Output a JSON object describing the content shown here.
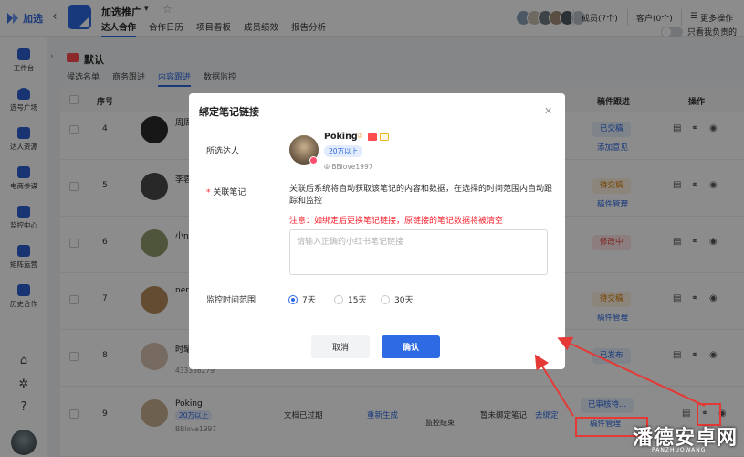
{
  "colors": {
    "accent": "#2d6ae3",
    "danger": "#f5222d",
    "annotation": "#e53935"
  },
  "app": {
    "name": "加选"
  },
  "project": {
    "name": "加选推广"
  },
  "nav_tabs": [
    "达人合作",
    "合作日历",
    "项目看板",
    "成员绩效",
    "报告分析"
  ],
  "top_right": {
    "members": "成员(7个)",
    "customers": "客户(0个)",
    "more": "更多操作"
  },
  "sidebar": [
    {
      "label": "工作台",
      "icon": "dashboard-icon"
    },
    {
      "label": "选号广场",
      "icon": "user-search-icon"
    },
    {
      "label": "达人资源",
      "icon": "star-folder-icon"
    },
    {
      "label": "电商参谋",
      "icon": "bag-icon"
    },
    {
      "label": "监控中心",
      "icon": "monitor-icon"
    },
    {
      "label": "矩阵运营",
      "icon": "matrix-icon"
    },
    {
      "label": "历史合作",
      "icon": "history-icon"
    }
  ],
  "main": {
    "title": "默认",
    "sub_tabs": [
      "候选名单",
      "商务跟进",
      "内容跟进",
      "数据监控"
    ],
    "only_mine": "只看我负责的",
    "columns": {
      "index": "序号",
      "followup": "稿件跟进",
      "ops": "操作"
    }
  },
  "rows": [
    {
      "num": "4",
      "name": "周周",
      "id": "",
      "status": "已交稿",
      "link": "添加意见"
    },
    {
      "num": "5",
      "name": "李蓉",
      "id": "",
      "status": "待交稿",
      "link": "稿件管理"
    },
    {
      "num": "6",
      "name": "小n",
      "id": "",
      "status": "修改中",
      "link": ""
    },
    {
      "num": "7",
      "name": "ner",
      "id": "",
      "status": "待交稿",
      "link": "稿件管理"
    },
    {
      "num": "8",
      "name": "时髦",
      "id": "433336279",
      "status": "已发布",
      "link": ""
    },
    {
      "num": "9",
      "name": "Poking",
      "id": "BBlove1997",
      "tier": "20万以上",
      "status": "已审核待...",
      "link": "稿件管理",
      "note_status": "文档已过期",
      "note_action": "重新生成",
      "monitor_status": "监控结束",
      "bind_status": "暂未绑定笔记",
      "bind_action": "去绑定"
    }
  ],
  "modal": {
    "title": "绑定笔记链接",
    "kol_label": "所选达人",
    "kol_name": "Poking",
    "kol_tier": "20万以上",
    "kol_id": "BBlove1997",
    "note_label": "关联笔记",
    "note_desc": "关联后系统将自动获取该笔记的内容和数据，在选择的时间范围内自动跟踪和监控",
    "note_warning": "注意：如绑定后更换笔记链接，原链接的笔记数据将被清空",
    "note_placeholder": "请输入正确的小红书笔记链接",
    "range_label": "监控时间范围",
    "ranges": [
      "7天",
      "15天",
      "30天"
    ],
    "cancel": "取消",
    "confirm": "确认"
  },
  "watermark": {
    "main": "潘德安卓网",
    "sub": "PANZHUOWANG"
  }
}
